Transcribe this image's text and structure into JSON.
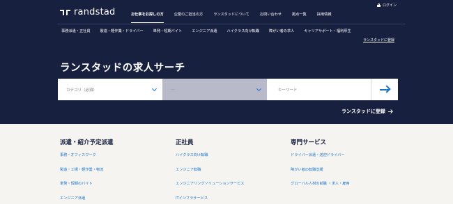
{
  "brand": {
    "logo_text": "randstad",
    "logo_icon": "randstad-logo-icon"
  },
  "login": {
    "label": "ログイン",
    "icon": "lock-icon"
  },
  "topnav": [
    {
      "label": "お仕事をお探しの方",
      "active": true
    },
    {
      "label": "企業のご担当の方"
    },
    {
      "label": "ランスタッドについて"
    },
    {
      "label": "お問い合わせ"
    },
    {
      "label": "拠点一覧"
    },
    {
      "label": "採用情報"
    }
  ],
  "subnav": [
    {
      "label": "事務派遣・正社員"
    },
    {
      "label": "製造・軽作業・ドライバー"
    },
    {
      "label": "単発・短期バイト"
    },
    {
      "label": "エンジニア派遣"
    },
    {
      "label": "ハイクラス向け転職"
    },
    {
      "label": "障がい者の求人"
    },
    {
      "label": "キャリアサポート・福利厚生"
    }
  ],
  "register_small": "ランスタッドに登録",
  "search": {
    "title": "ランスタッドの求人サーチ",
    "category_placeholder": "カテゴリ（必須）",
    "second_placeholder": "---",
    "keyword_placeholder": "キーワード",
    "submit_icon": "arrow-right-icon"
  },
  "register_big": {
    "label": "ランスタッドに登録",
    "icon": "arrow-right-icon"
  },
  "colors": {
    "navy": "#17203f",
    "link_blue": "#1d75c7",
    "disabled_select": "#b9bac9"
  },
  "columns": [
    {
      "title": "派遣・紹介予定派遣",
      "links": [
        "事務・オフィスワーク",
        "製造・工場・軽作業・物流",
        "単発・短期のバイト",
        "エンジニア派遣"
      ]
    },
    {
      "title": "正社員",
      "links": [
        "ハイクラス向け転職",
        "エンジニア転職",
        "エンジニアリングソリューションサービス",
        "ITインフラサービス"
      ]
    },
    {
      "title": "専門サービス",
      "links": [
        "ドライバー派遣・送迎ドライバー",
        "障がい者の転職支援",
        "グローバル人材の就職 ・求人・雇用"
      ]
    }
  ]
}
